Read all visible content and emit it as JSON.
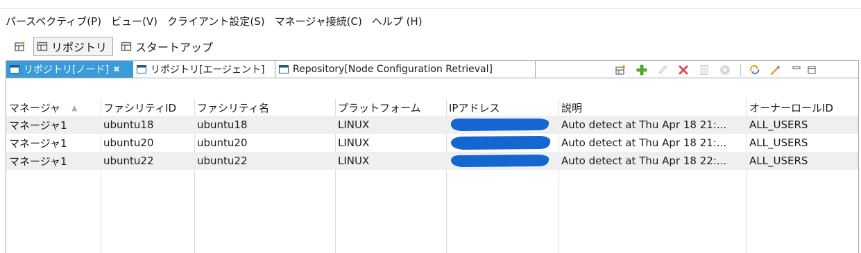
{
  "menubar": {
    "items": [
      "パースペクティブ(P)",
      "ビュー(V)",
      "クライアント設定(S)",
      "マネージャ接続(C)",
      "ヘルプ (H)"
    ]
  },
  "perspectives": {
    "items": [
      {
        "label": "リポジトリ",
        "active": true
      },
      {
        "label": "スタートアップ",
        "active": false
      }
    ]
  },
  "tabs": [
    {
      "label": "リポジトリ[ノード]",
      "active": true
    },
    {
      "label": "リポジトリ[エージェント]",
      "active": false
    },
    {
      "label": "Repository[Node Configuration Retrieval]",
      "active": false
    }
  ],
  "colors": {
    "active_tab": "#3a9bd8",
    "row_shade": "#efefef",
    "redaction": "#1466d0",
    "add_icon": "#4caf28",
    "delete_icon": "#e04a4a"
  },
  "table": {
    "columns": [
      "マネージャ",
      "ファシリティID",
      "ファシリティ名",
      "プラットフォーム",
      "IPアドレス",
      "説明",
      "オーナーロールID"
    ],
    "rows": [
      {
        "manager": "マネージャ1",
        "facility_id": "ubuntu18",
        "facility_name": "ubuntu18",
        "platform": "LINUX",
        "ip": "",
        "description": "Auto detect at Thu Apr 18 21:...",
        "owner": "ALL_USERS"
      },
      {
        "manager": "マネージャ1",
        "facility_id": "ubuntu20",
        "facility_name": "ubuntu20",
        "platform": "LINUX",
        "ip": "",
        "description": "Auto detect at Thu Apr 18 21:...",
        "owner": "ALL_USERS"
      },
      {
        "manager": "マネージャ1",
        "facility_id": "ubuntu22",
        "facility_name": "ubuntu22",
        "platform": "LINUX",
        "ip": "",
        "description": "Auto detect at Thu Apr 18 22:...",
        "owner": "ALL_USERS"
      }
    ]
  }
}
